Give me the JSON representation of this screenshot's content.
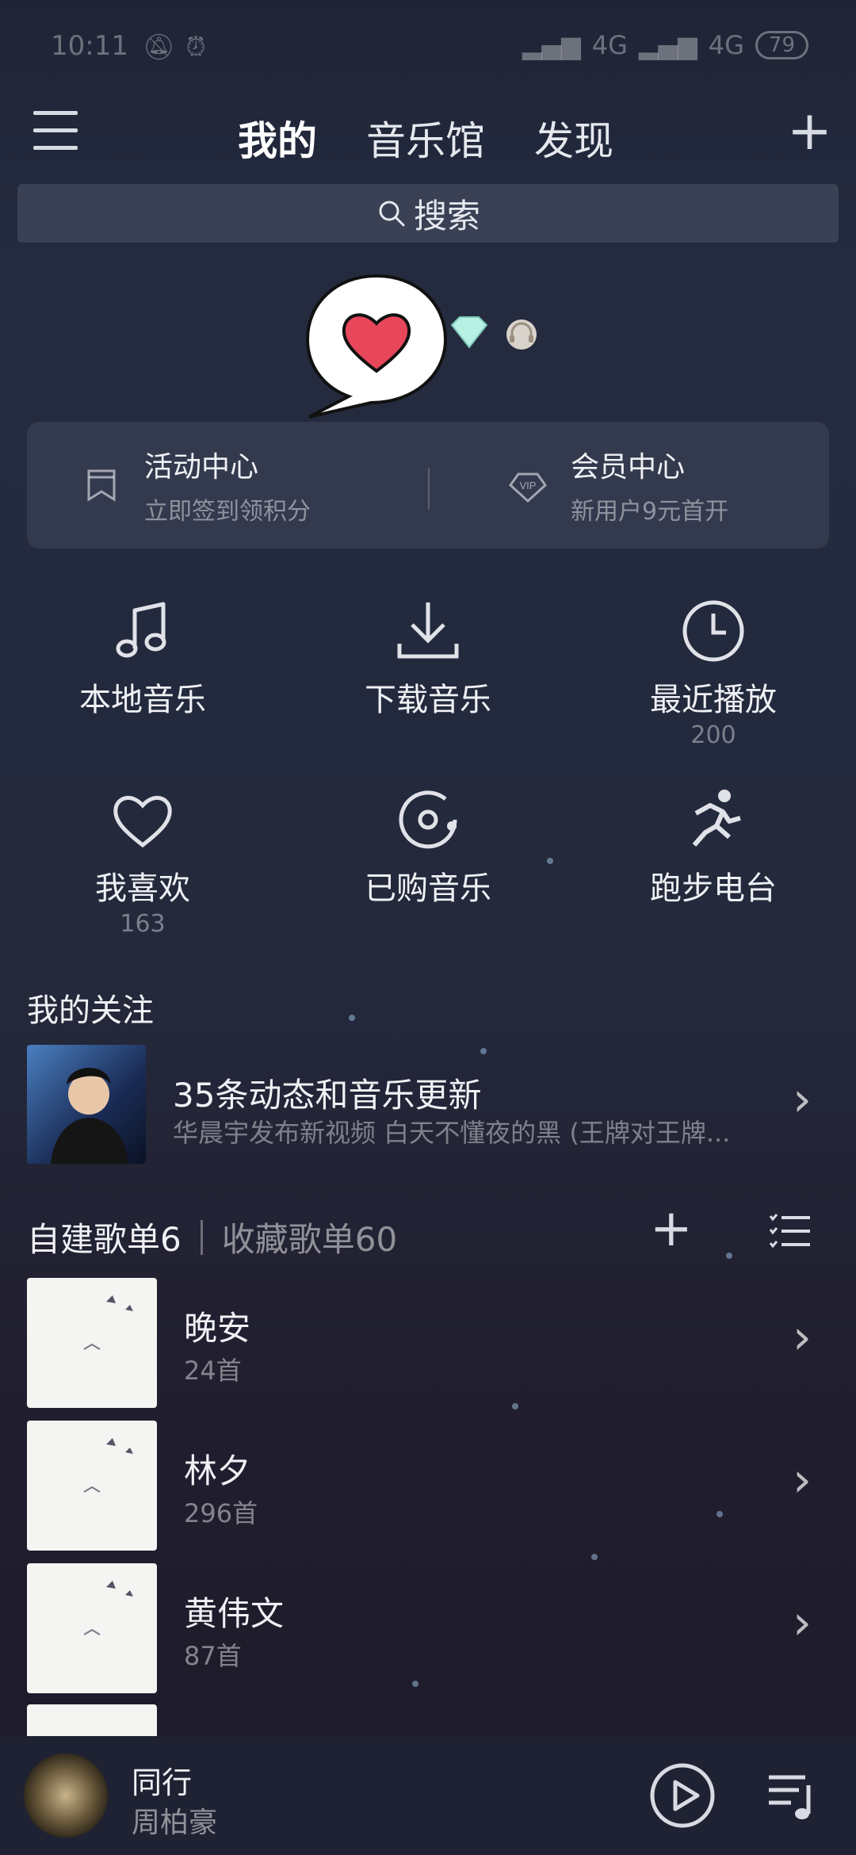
{
  "status_bar": {
    "time": "10:11",
    "network1": "4G",
    "network2": "4G",
    "battery": "79"
  },
  "nav": {
    "tabs": [
      "我的",
      "音乐馆",
      "发现"
    ]
  },
  "search": {
    "placeholder": "搜索"
  },
  "activity_card": {
    "left": {
      "title": "活动中心",
      "subtitle": "立即签到领积分"
    },
    "right": {
      "title": "会员中心",
      "subtitle": "新用户9元首开"
    }
  },
  "shortcuts": [
    {
      "label": "本地音乐",
      "count": "",
      "icon": "music-note-icon"
    },
    {
      "label": "下载音乐",
      "count": "",
      "icon": "download-icon"
    },
    {
      "label": "最近播放",
      "count": "200",
      "icon": "clock-icon"
    },
    {
      "label": "我喜欢",
      "count": "163",
      "icon": "heart-icon"
    },
    {
      "label": "已购音乐",
      "count": "",
      "icon": "purchased-disc-icon"
    },
    {
      "label": "跑步电台",
      "count": "",
      "icon": "running-icon"
    }
  ],
  "follows": {
    "section_title": "我的关注",
    "title": "35条动态和音乐更新",
    "subtitle": "华晨宇发布新视频 白天不懂夜的黑 (王牌对王牌..."
  },
  "playlists": {
    "tab_created": "自建歌单6",
    "tab_collected": "收藏歌单60",
    "items": [
      {
        "name": "晚安",
        "count": "24首"
      },
      {
        "name": "林夕",
        "count": "296首"
      },
      {
        "name": "黄伟文",
        "count": "87首"
      }
    ]
  },
  "player": {
    "title": "同行",
    "artist": "周柏豪"
  },
  "colors": {
    "background": "#252b3f",
    "card": "#3a4155",
    "heart": "#e8465a"
  }
}
